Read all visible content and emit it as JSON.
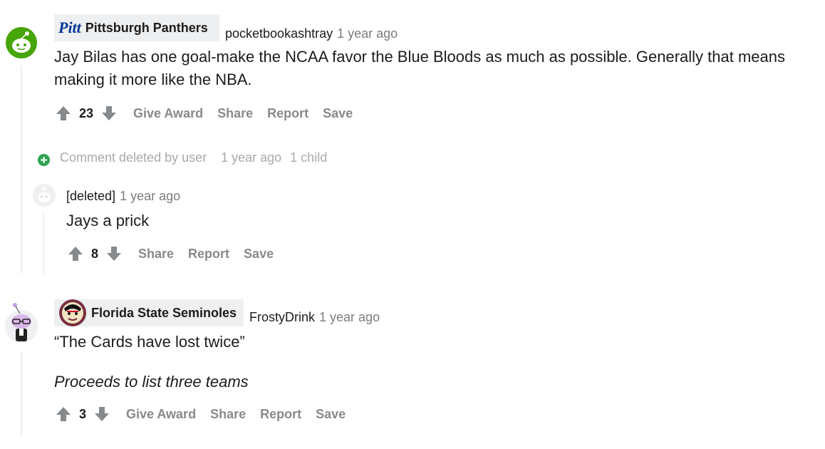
{
  "comments": [
    {
      "flair": "Pittsburgh Panthers",
      "flair_logo_text": "Pitt",
      "username": "pocketbookashtray",
      "time": "1 year ago",
      "body": "Jay Bilas has one goal-make the NCAA favor the Blue Bloods as much as possible. Generally that means making it more like the NBA.",
      "score": "23",
      "actions": [
        "Give Award",
        "Share",
        "Report",
        "Save"
      ]
    },
    {
      "deleted_row": {
        "label": "Comment deleted by user",
        "time": "1 year ago",
        "children": "1 child"
      }
    },
    {
      "username": "[deleted]",
      "time": "1 year ago",
      "body": "Jays a prick",
      "score": "8",
      "actions": [
        "Share",
        "Report",
        "Save"
      ]
    },
    {
      "flair": "Florida State Seminoles",
      "username": "FrostyDrink",
      "time": "1 year ago",
      "body_line1": "“The Cards have lost twice”",
      "body_line2": "Proceeds to list three teams",
      "score": "3",
      "actions": [
        "Give Award",
        "Share",
        "Report",
        "Save"
      ]
    }
  ],
  "colors": {
    "meta_gray": "#7c7c7c",
    "action_gray": "#878a8c",
    "thread_line": "#edeff1",
    "expand_green": "#2ea44f"
  }
}
